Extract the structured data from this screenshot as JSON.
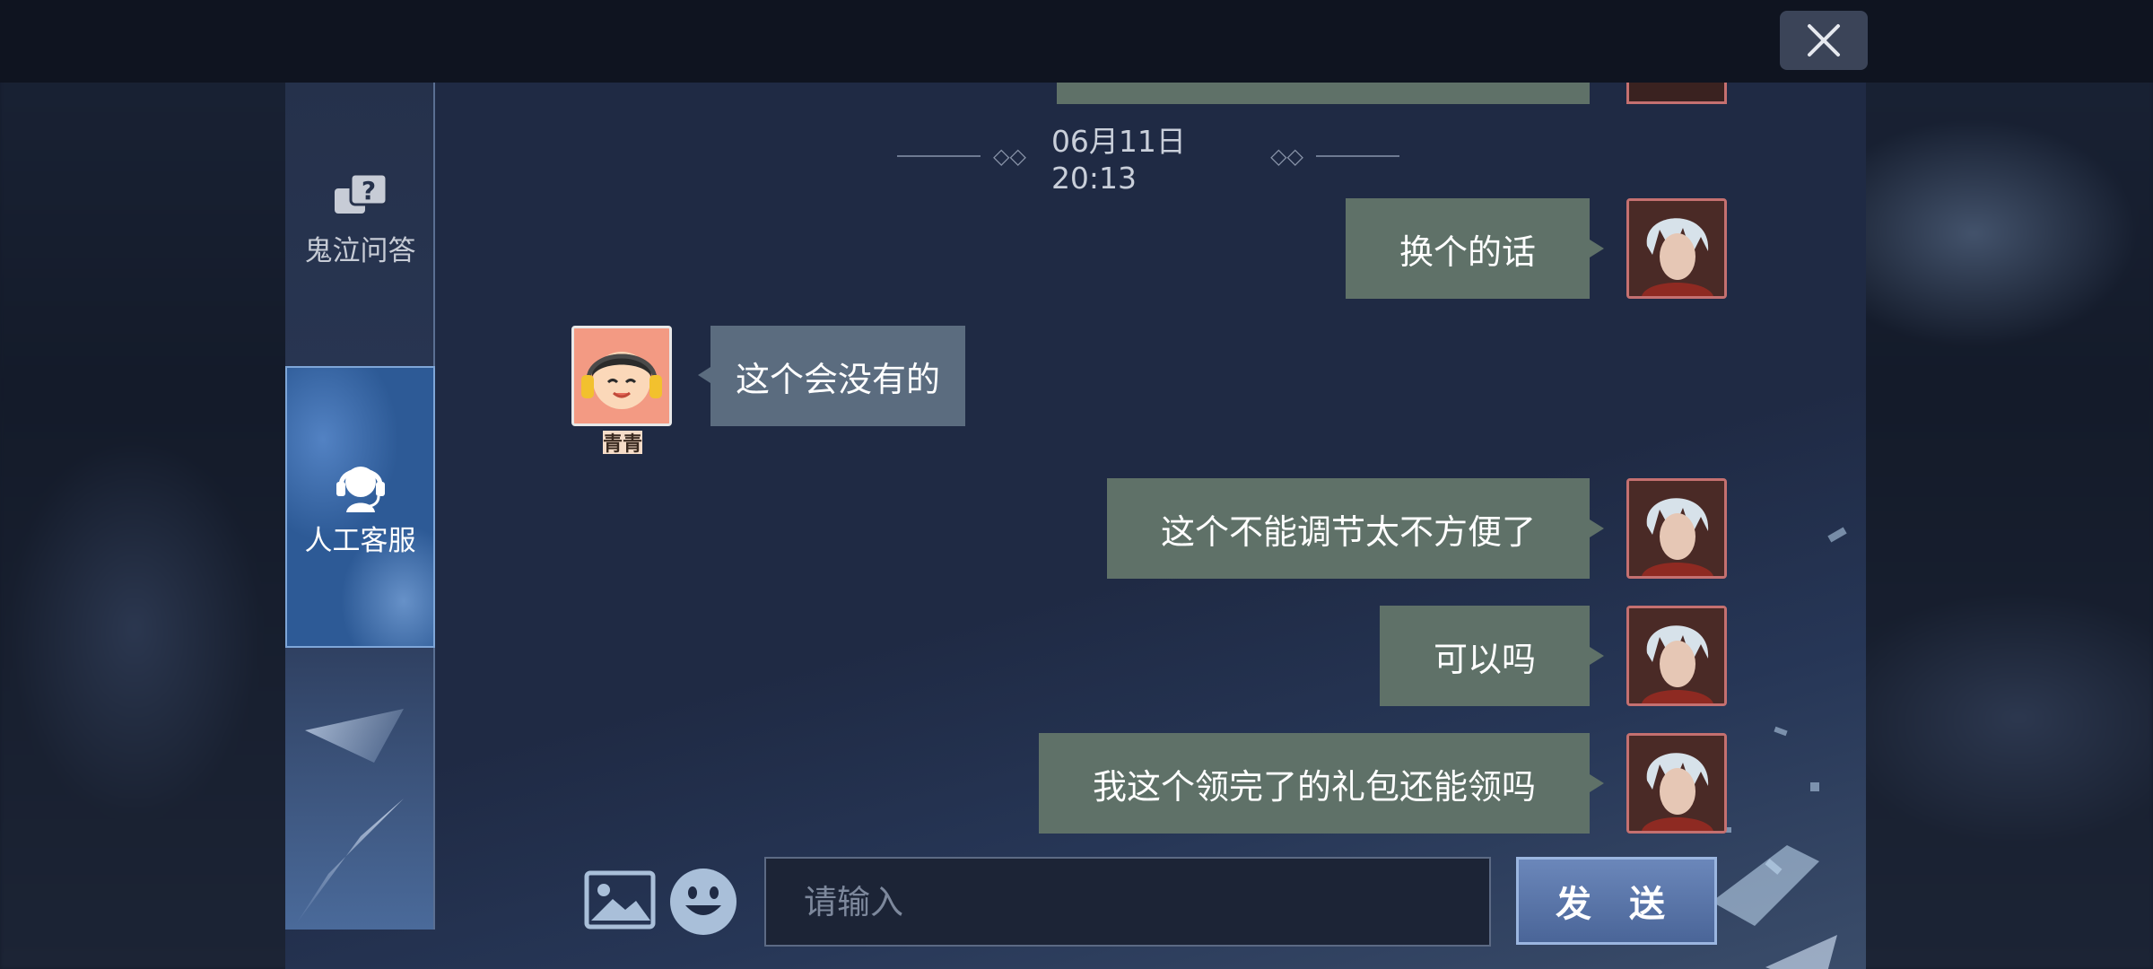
{
  "window": {
    "close_icon": "close-x-icon"
  },
  "sidebar": {
    "items": [
      {
        "label": "鬼泣问答",
        "icon": "question-chat-icon"
      },
      {
        "label": "人工客服",
        "icon": "headset-support-icon"
      }
    ]
  },
  "chat": {
    "timestamp": "06月11日 20:13",
    "messages": [
      {
        "from": "user",
        "text": "换个的话"
      },
      {
        "from": "agent",
        "text": "这个会没有的",
        "name": "青青"
      },
      {
        "from": "user",
        "text": "这个不能调节太不方便了"
      },
      {
        "from": "user",
        "text": "可以吗"
      },
      {
        "from": "user",
        "text": "我这个领完了的礼包还能领吗"
      }
    ]
  },
  "composer": {
    "image_icon": "image-icon",
    "emoji_icon": "emoji-icon",
    "placeholder": "请输入",
    "value": "",
    "send_label": "发 送"
  },
  "colors": {
    "user_bubble": "#5f7168",
    "agent_bubble": "#5b6c7f",
    "panel_bg": "#1f2a44",
    "send_button": "#5a76a9"
  }
}
